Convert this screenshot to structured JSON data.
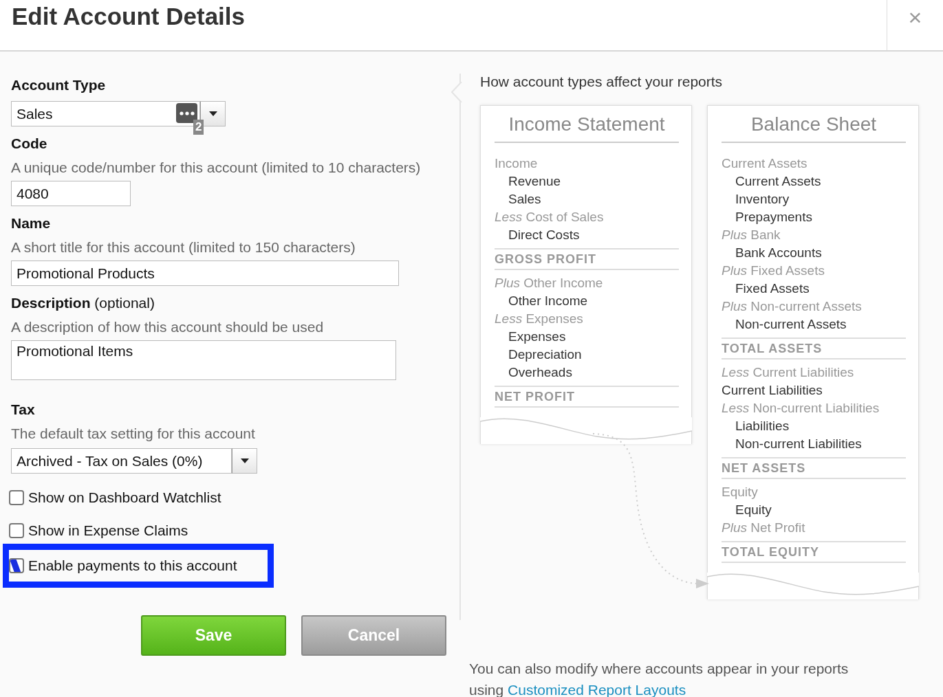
{
  "dialog": {
    "title": "Edit Account Details",
    "close": "×"
  },
  "form": {
    "account_type": {
      "label": "Account Type",
      "value": "Sales",
      "badge": "2"
    },
    "code": {
      "label": "Code",
      "hint": "A unique code/number for this account (limited to 10 characters)",
      "value": "4080"
    },
    "name": {
      "label": "Name",
      "hint": "A short title for this account (limited to 150 characters)",
      "value": "Promotional Products"
    },
    "description": {
      "label": "**Description** (optional)",
      "hint": "A description of how this account should be used",
      "value": "Promotional Items"
    },
    "tax": {
      "label": "Tax",
      "hint": "The default tax setting for this account",
      "value": "Archived - Tax on Sales (0%)"
    },
    "checkboxes": [
      {
        "label": "Show on Dashboard Watchlist",
        "checked": false,
        "highlighted": false
      },
      {
        "label": "Show in Expense Claims",
        "checked": false,
        "highlighted": false
      },
      {
        "label": "Enable payments to this account",
        "checked": true,
        "highlighted": true
      }
    ],
    "buttons": [
      {
        "label": "Save",
        "kind": "primary"
      },
      {
        "label": "Cancel",
        "kind": "secondary"
      }
    ]
  },
  "reports": {
    "heading": "How account types affect your reports",
    "cards": [
      {
        "title": "Income Statement",
        "lines": [
          {
            "kind": "group",
            "text": "Income"
          },
          {
            "kind": "account",
            "text": "Revenue"
          },
          {
            "kind": "account",
            "text": "Sales"
          },
          {
            "kind": "group",
            "text": "*Less* Cost of Sales"
          },
          {
            "kind": "account",
            "text": "Direct Costs"
          },
          {
            "kind": "total",
            "text": "GROSS PROFIT"
          },
          {
            "kind": "group",
            "text": "*Plus* Other Income"
          },
          {
            "kind": "account",
            "text": "Other Income"
          },
          {
            "kind": "group",
            "text": "*Less* Expenses"
          },
          {
            "kind": "account",
            "text": "Expenses"
          },
          {
            "kind": "account",
            "text": "Depreciation"
          },
          {
            "kind": "account",
            "text": "Overheads"
          },
          {
            "kind": "total",
            "text": "NET PROFIT"
          }
        ]
      },
      {
        "title": "Balance Sheet",
        "lines": [
          {
            "kind": "group",
            "text": "Current Assets"
          },
          {
            "kind": "account",
            "text": "Current Assets"
          },
          {
            "kind": "account",
            "text": "Inventory"
          },
          {
            "kind": "account",
            "text": "Prepayments"
          },
          {
            "kind": "group",
            "text": "*Plus* Bank"
          },
          {
            "kind": "account",
            "text": "Bank Accounts"
          },
          {
            "kind": "group",
            "text": "*Plus* Fixed Assets"
          },
          {
            "kind": "account",
            "text": "Fixed Assets"
          },
          {
            "kind": "group",
            "text": "*Plus* Non-current Assets"
          },
          {
            "kind": "account",
            "text": "Non-current Assets"
          },
          {
            "kind": "total",
            "text": "TOTAL ASSETS"
          },
          {
            "kind": "group",
            "text": "*Less* Current Liabilities"
          },
          {
            "kind": "flat-account",
            "text": "Current Liabilities"
          },
          {
            "kind": "group",
            "text": "*Less* Non-current Liabilities"
          },
          {
            "kind": "account",
            "text": "Liabilities"
          },
          {
            "kind": "account",
            "text": "Non-current Liabilities"
          },
          {
            "kind": "total",
            "text": "NET ASSETS"
          },
          {
            "kind": "group",
            "text": "Equity"
          },
          {
            "kind": "account",
            "text": "Equity"
          },
          {
            "kind": "group",
            "text": "*Plus* Net Profit"
          },
          {
            "kind": "total",
            "text": "TOTAL EQUITY"
          }
        ]
      }
    ],
    "footer": "You can also modify where accounts appear in your reports using",
    "link": "Customized Report Layouts"
  }
}
